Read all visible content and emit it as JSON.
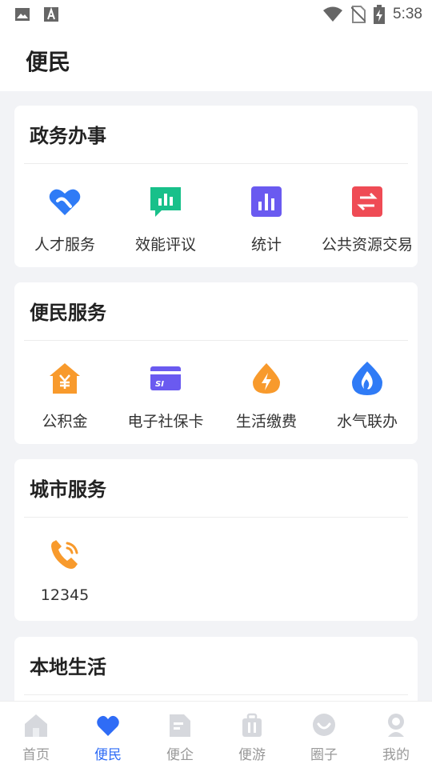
{
  "status_bar": {
    "time": "5:38"
  },
  "header": {
    "title": "便民"
  },
  "sections": [
    {
      "title": "政务办事",
      "items": [
        {
          "label": "人才服务",
          "icon": "talent-heart-icon",
          "color": "#2f7bf6"
        },
        {
          "label": "效能评议",
          "icon": "chat-bars-icon",
          "color": "#18c08a"
        },
        {
          "label": "统计",
          "icon": "bar-chart-icon",
          "color": "#6a5af0"
        },
        {
          "label": "公共资源交易",
          "icon": "exchange-icon",
          "color": "#ef4b55"
        }
      ]
    },
    {
      "title": "便民服务",
      "items": [
        {
          "label": "公积金",
          "icon": "house-yen-icon",
          "color": "#f89a2c"
        },
        {
          "label": "电子社保卡",
          "icon": "si-card-icon",
          "color": "#6a5af0"
        },
        {
          "label": "生活缴费",
          "icon": "bolt-drop-icon",
          "color": "#f89a2c"
        },
        {
          "label": "水气联办",
          "icon": "flame-drop-icon",
          "color": "#2f7bf6"
        }
      ]
    },
    {
      "title": "城市服务",
      "items": [
        {
          "label": "12345",
          "icon": "phone-icon",
          "color": "#f89a2c"
        }
      ]
    },
    {
      "title": "本地生活",
      "items": []
    }
  ],
  "tabbar": {
    "active": "便民",
    "items": [
      {
        "label": "首页",
        "icon": "home-icon"
      },
      {
        "label": "便民",
        "icon": "heart-icon"
      },
      {
        "label": "便企",
        "icon": "document-icon"
      },
      {
        "label": "便游",
        "icon": "luggage-icon"
      },
      {
        "label": "圈子",
        "icon": "chat-circle-icon"
      },
      {
        "label": "我的",
        "icon": "user-icon"
      }
    ]
  }
}
